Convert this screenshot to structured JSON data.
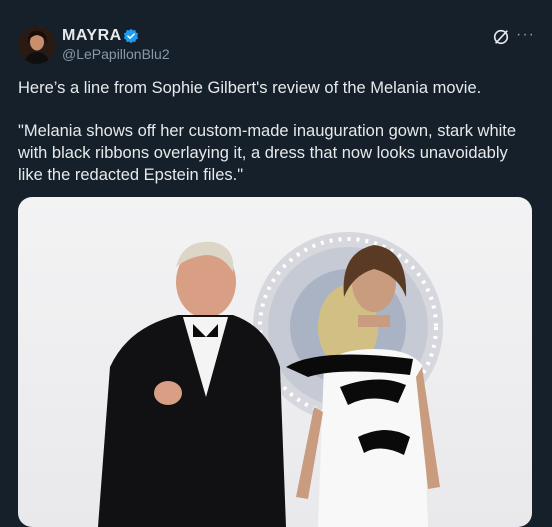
{
  "user": {
    "display_name": "MAYRA",
    "handle": "@LePapillonBlu2"
  },
  "icons": {
    "verified": "verified-badge-icon",
    "grok": "grok-icon",
    "more": "more-icon"
  },
  "tweet": {
    "line1": "Here’s a line from Sophie Gilbert's review of the Melania movie.",
    "line2": "\"Melania shows off her custom-made inauguration gown, stark white with black ribbons overlaying it, a dress that now looks unavoidably like the redacted Epstein files.\""
  },
  "colors": {
    "background": "#15202b",
    "verified": "#1d9bf0"
  }
}
